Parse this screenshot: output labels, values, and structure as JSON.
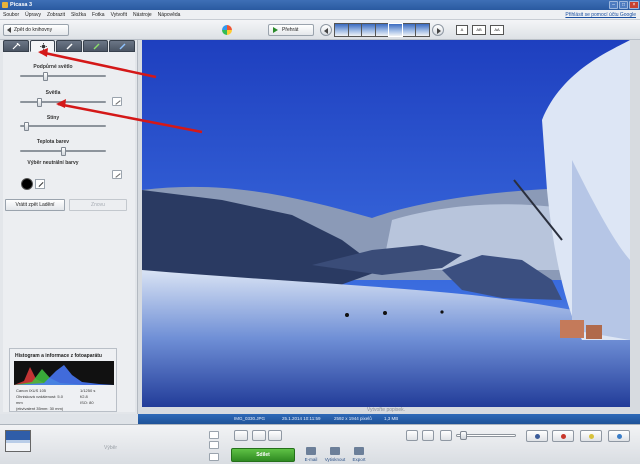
{
  "window": {
    "title": "Picasa 3"
  },
  "menu": {
    "items": [
      "Soubor",
      "Úpravy",
      "Zobrazit",
      "Složka",
      "Fotka",
      "Vytvořit",
      "Nástroje",
      "Nápověda"
    ],
    "signin": "Přihlásit se pomocí účtu Google"
  },
  "toolbar": {
    "back_label": "Zpět do knihovny",
    "play_label": "Přehrát",
    "view_modes": [
      "A",
      "AB",
      "AA"
    ]
  },
  "panel": {
    "sliders": [
      {
        "label": "Podpůrné světlo",
        "value": 0.28
      },
      {
        "label": "Světla",
        "value": 0.2
      },
      {
        "label": "Stíny",
        "value": 0.04
      },
      {
        "label": "Teplota barev",
        "value": 0.5
      }
    ],
    "neutral_label": "Výběr neutrální barvy",
    "undo_label": "Vrátit zpět Ladění",
    "redo_label": "Znovu"
  },
  "histogram": {
    "title": "Histogram a informace z fotoaparátu",
    "rows": [
      {
        "left": "Canon IXUS 105",
        "right": "1/1250 s"
      },
      {
        "left": "Ohnisková vzdálenost: 5.0",
        "right": "f/2.8"
      },
      {
        "left": "mm",
        "right": "ISO: 80"
      },
      {
        "left": "(ekvivalent 35mm: 30 mm)",
        "right": ""
      }
    ]
  },
  "photo": {
    "caption": "Vytvořte popisek."
  },
  "status": {
    "filename": "IMG_0330.JPG",
    "datetime": "25.1.2014 10:11:59",
    "dims": "2592 x 1944 pixelů",
    "size": "1,3 MB"
  },
  "tray": {
    "selection_label": "Výběr",
    "share_label": "Sdílet",
    "actions": [
      "E-mail",
      "Vytisknout",
      "Export"
    ]
  },
  "colors": {
    "accent": "#2e69b8",
    "share_green": "#3da12e",
    "annotation_red": "#d41818"
  }
}
